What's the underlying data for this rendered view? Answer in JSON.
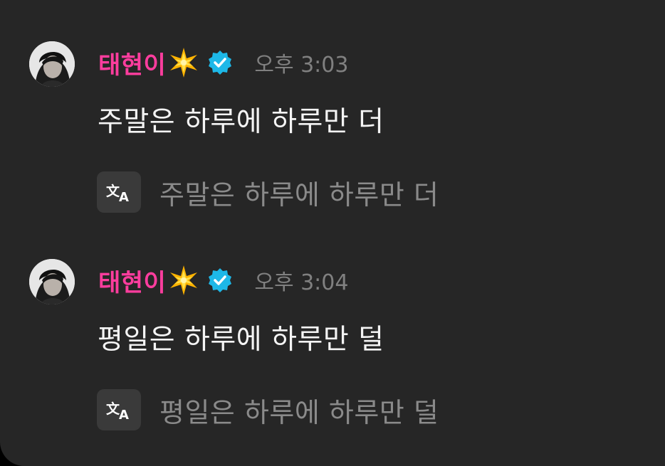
{
  "messages": [
    {
      "author": "태현이",
      "author_emoji": "sparkle-star",
      "verified": true,
      "time": "오후 3:03",
      "text": "주말은 하루에 하루만 더",
      "translation": "주말은 하루에 하루만 더"
    },
    {
      "author": "태현이",
      "author_emoji": "sparkle-star",
      "verified": true,
      "time": "오후 3:04",
      "text": "평일은 하루에 하루만 덜",
      "translation": "평일은 하루에 하루만 덜"
    }
  ],
  "colors": {
    "background": "#262626",
    "author_name": "#ff3d9e",
    "verified_badge": "#1db8e8",
    "time": "#808080",
    "message_text": "#f4f4f4",
    "translation_text": "#8a8a8a",
    "translate_button": "#3a3a3a"
  },
  "icons": {
    "translate": "translate-icon",
    "verified": "verified-badge-icon",
    "sparkle": "sparkle-star-icon"
  }
}
